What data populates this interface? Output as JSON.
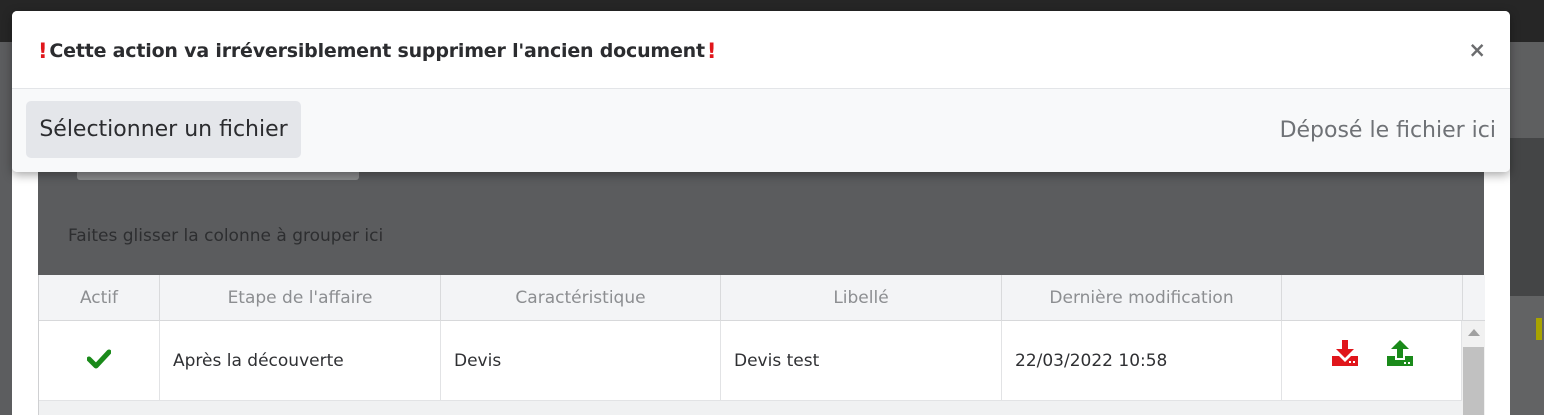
{
  "modal": {
    "title": "Cette action va irréversiblement supprimer l'ancien document",
    "warning_mark": "!",
    "close": "×",
    "select_button": "Sélectionner un fichier",
    "drop_hint": "Déposé le fichier ici"
  },
  "grid": {
    "group_hint": "Faites glisser la colonne à grouper ici",
    "columns": [
      "Actif",
      "Etape de l'affaire",
      "Caractéristique",
      "Libellé",
      "Dernière modification",
      ""
    ],
    "rows": [
      {
        "actif_icon": "check-icon",
        "etape": "Après la découverte",
        "caracteristique": "Devis",
        "libelle": "Devis test",
        "modification": "22/03/2022 10:58",
        "actions": [
          "download-icon",
          "upload-icon"
        ]
      }
    ]
  },
  "colors": {
    "warning": "#e0161b",
    "check": "#1a8a1a",
    "download": "#e0161b",
    "upload": "#1a8a1a"
  }
}
